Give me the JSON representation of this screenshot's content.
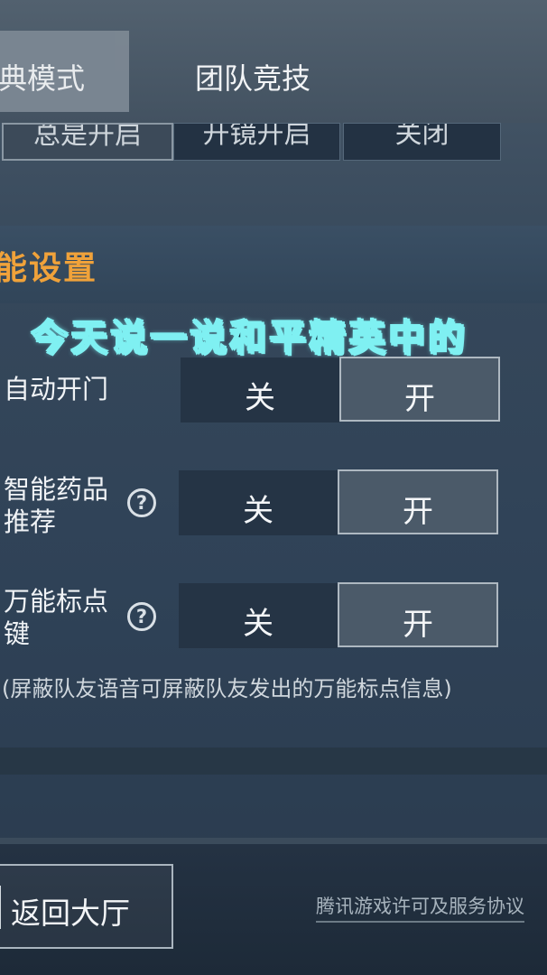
{
  "tabs": [
    {
      "label": "典模式",
      "active": true
    },
    {
      "label": "团队竞技",
      "active": false
    }
  ],
  "scope_row": [
    "总是开启",
    "开镜开启",
    "关闭"
  ],
  "section": {
    "title": "能设置"
  },
  "overlay_caption": "今天说一说和平精英中的",
  "settings": [
    {
      "label_line1": "自动开门",
      "label_line2": "",
      "help": false,
      "off": "关",
      "on": "开",
      "value": "开"
    },
    {
      "label_line1": "智能药品",
      "label_line2": "推荐",
      "help": true,
      "off": "关",
      "on": "开",
      "value": "开"
    },
    {
      "label_line1": "万能标点",
      "label_line2": "键",
      "help": true,
      "off": "关",
      "on": "开",
      "value": "开"
    }
  ],
  "note": "(屏蔽队友语音可屏蔽队友发出的万能标点信息)",
  "help_glyph": "?",
  "footer": {
    "back_label": "返回大厅",
    "license_link": "腾讯游戏许可及服务协议"
  }
}
